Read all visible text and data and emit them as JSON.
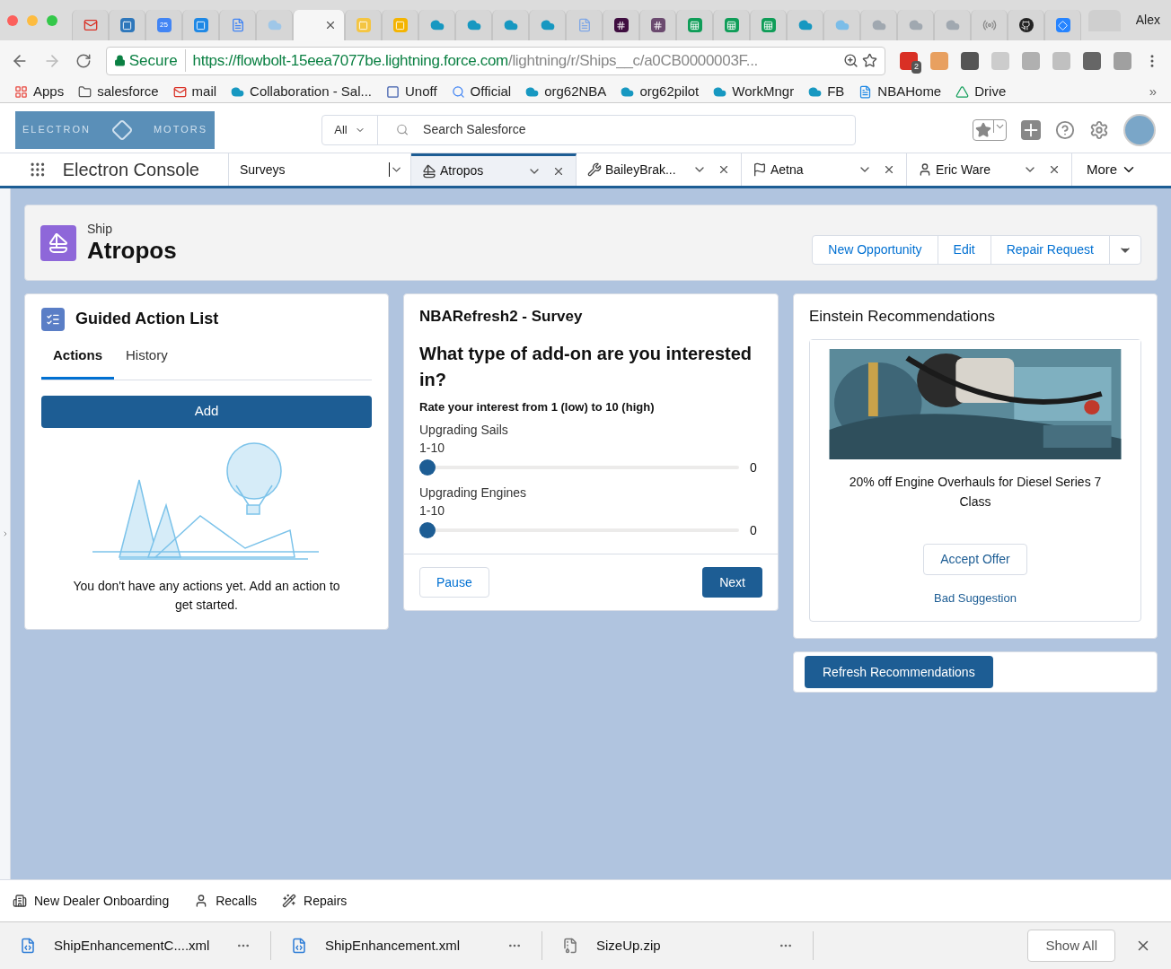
{
  "browser": {
    "tabs": [
      {
        "kind": "mail",
        "color": "#d93025",
        "selected": false
      },
      {
        "kind": "square",
        "color": "#2e77bb",
        "selected": false
      },
      {
        "kind": "calendar",
        "color": "#4285f4",
        "badge": "25",
        "selected": false
      },
      {
        "kind": "square",
        "color": "#1e88e5",
        "selected": false
      },
      {
        "kind": "doc",
        "color": "#4285f4",
        "selected": false
      },
      {
        "kind": "cloud",
        "color": "#9fc7e8",
        "selected": false
      },
      {
        "selected": true
      },
      {
        "kind": "square",
        "color": "#f4c542",
        "selected": false
      },
      {
        "kind": "square",
        "color": "#f4b400",
        "selected": false
      },
      {
        "kind": "cloud",
        "color": "#1798c1",
        "selected": false
      },
      {
        "kind": "cloud",
        "color": "#1798c1",
        "selected": false
      },
      {
        "kind": "cloud",
        "color": "#1798c1",
        "selected": false
      },
      {
        "kind": "cloud",
        "color": "#1798c1",
        "selected": false
      },
      {
        "kind": "doc",
        "color": "#7fa7e6",
        "selected": false
      },
      {
        "kind": "hash",
        "color": "#3f0e40",
        "selected": false
      },
      {
        "kind": "hash",
        "color": "#6b4a6f",
        "selected": false
      },
      {
        "kind": "sheet",
        "color": "#0f9d58",
        "selected": false
      },
      {
        "kind": "sheet",
        "color": "#0f9d58",
        "selected": false
      },
      {
        "kind": "sheet",
        "color": "#0f9d58",
        "selected": false
      },
      {
        "kind": "cloud",
        "color": "#1798c1",
        "selected": false
      },
      {
        "kind": "cloud",
        "color": "#7bbde8",
        "selected": false
      },
      {
        "kind": "cloud",
        "color": "#a0a8b0",
        "selected": false
      },
      {
        "kind": "cloud",
        "color": "#a0a8b0",
        "selected": false
      },
      {
        "kind": "cloud",
        "color": "#a0a8b0",
        "selected": false
      },
      {
        "kind": "radio",
        "color": "#8a8a8a",
        "selected": false
      },
      {
        "kind": "github",
        "color": "#222222",
        "selected": false
      },
      {
        "kind": "diamond",
        "color": "#2684ff",
        "selected": false
      }
    ],
    "profile": "Alex",
    "secure": "Secure",
    "url_host": "https://flowbolt-15eea7077be.lightning.force.com",
    "url_path": "/lightning/r/Ships__c/a0CB0000003F...",
    "extensions": [
      {
        "color": "#d93025",
        "badge": "2"
      },
      {
        "color": "#e8a060"
      },
      {
        "color": "#555555"
      },
      {
        "color": "#cccccc"
      },
      {
        "color": "#b0b0b0"
      },
      {
        "color": "#c0c0c0"
      },
      {
        "color": "#666666"
      },
      {
        "color": "#a0a0a0"
      }
    ],
    "bookmarks": [
      {
        "kind": "apps",
        "label": "Apps"
      },
      {
        "kind": "folder",
        "label": "salesforce"
      },
      {
        "kind": "mail",
        "label": "mail"
      },
      {
        "kind": "cloud",
        "label": "Collaboration - Sal..."
      },
      {
        "kind": "square",
        "label": "Unoff"
      },
      {
        "kind": "google",
        "label": "Official"
      },
      {
        "kind": "cloud",
        "label": "org62NBA"
      },
      {
        "kind": "cloud",
        "label": "org62pilot"
      },
      {
        "kind": "cloud",
        "label": "WorkMngr"
      },
      {
        "kind": "cloud",
        "label": "FB"
      },
      {
        "kind": "page",
        "label": "NBAHome"
      },
      {
        "kind": "drive",
        "label": "Drive"
      }
    ],
    "bookmarks_more": "»"
  },
  "header": {
    "logo": [
      "ELECTRON",
      "MOTORS"
    ],
    "search_scope": "All",
    "search_placeholder": "Search Salesforce"
  },
  "nav": {
    "app_name": "Electron Console",
    "tabs": [
      {
        "kind": "list",
        "label": "Surveys",
        "selected": false
      },
      {
        "kind": "ship",
        "label": "Atropos",
        "selected": true
      },
      {
        "kind": "wrench",
        "label": "BaileyBrak...",
        "selected": false
      },
      {
        "kind": "flag",
        "label": "Aetna",
        "selected": false
      },
      {
        "kind": "person",
        "label": "Eric Ware",
        "selected": false
      }
    ],
    "more": "More"
  },
  "record": {
    "type": "Ship",
    "name": "Atropos",
    "actions": [
      "New Opportunity",
      "Edit",
      "Repair Request"
    ]
  },
  "guided": {
    "title": "Guided Action List",
    "tabs": [
      {
        "label": "Actions",
        "selected": true
      },
      {
        "label": "History",
        "selected": false
      }
    ],
    "add": "Add",
    "empty": "You don't have any actions yet. Add an action to get started."
  },
  "survey": {
    "title": "NBARefresh2 - Survey",
    "question": "What type of add-on are you interested in?",
    "instruction": "Rate your interest from 1 (low) to 10 (high)",
    "sliders": [
      {
        "label": "Upgrading Sails",
        "range": "1-10",
        "level": 0,
        "reading": "0"
      },
      {
        "label": "Upgrading Engines",
        "range": "1-10",
        "level": 0,
        "reading": "0"
      }
    ],
    "pause": "Pause",
    "next": "Next"
  },
  "einstein": {
    "title": "Einstein Recommendations",
    "offer": "20% off Engine Overhauls for Diesel Series 7 Class",
    "accept": "Accept Offer",
    "reject": "Bad Suggestion",
    "refresh": "Refresh Recommendations"
  },
  "utility": [
    {
      "kind": "building",
      "label": "New Dealer Onboarding"
    },
    {
      "kind": "person",
      "label": "Recalls"
    },
    {
      "kind": "wand",
      "label": "Repairs"
    }
  ],
  "downloads": {
    "files": [
      {
        "kind": "code",
        "name": "ShipEnhancementC....xml"
      },
      {
        "kind": "code",
        "name": "ShipEnhancement.xml"
      },
      {
        "kind": "zip",
        "name": "SizeUp.zip"
      }
    ],
    "show_all": "Show All"
  }
}
